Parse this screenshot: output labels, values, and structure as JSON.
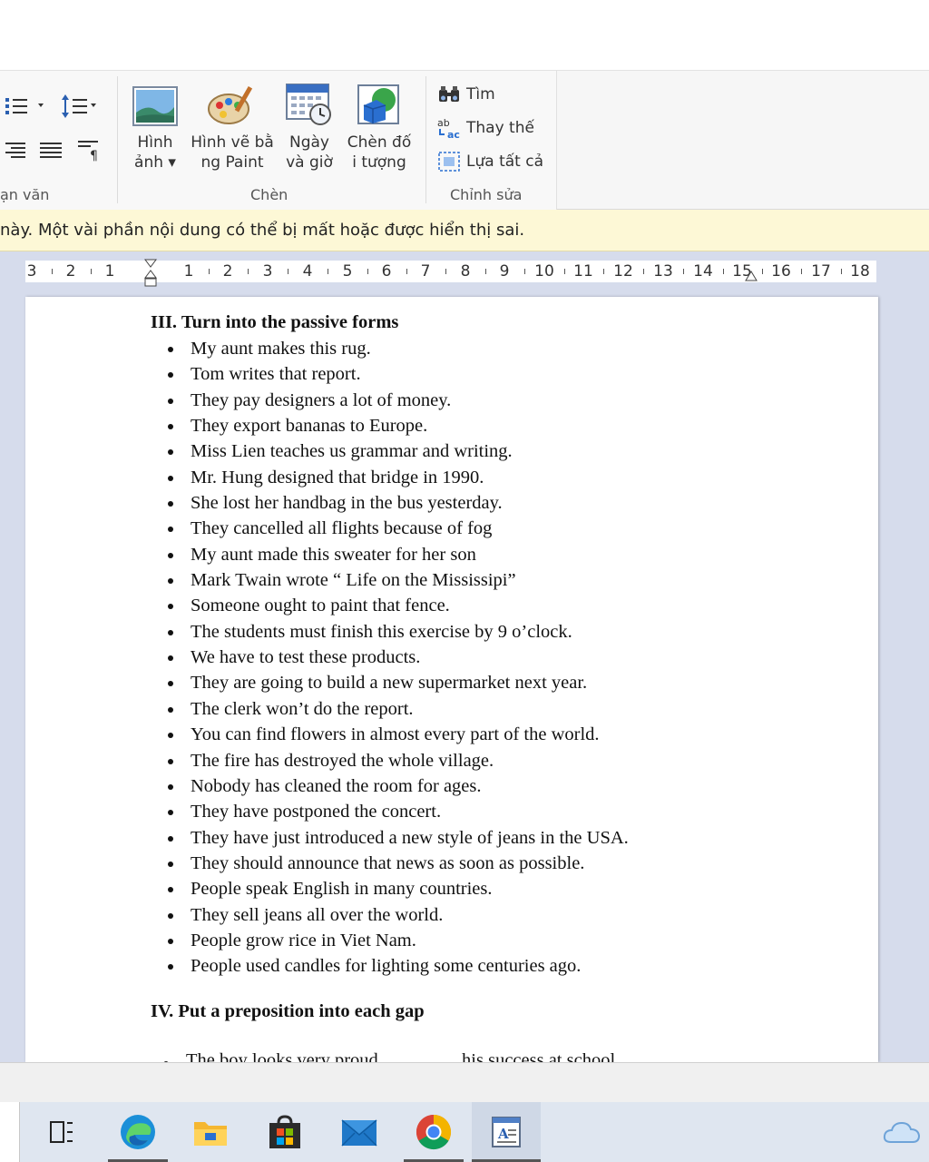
{
  "ribbon": {
    "groups": {
      "paragraph": "ạn văn",
      "insert": "Chèn",
      "editing": "Chỉnh sửa"
    },
    "insert_buttons": {
      "picture": {
        "line1": "Hình",
        "line2": "ảnh ▾"
      },
      "paint_drawing": {
        "line1": "Hình vẽ bằ",
        "line2": "ng Paint"
      },
      "date_time": {
        "line1": "Ngày",
        "line2": "và giờ"
      },
      "insert_object": {
        "line1": "Chèn đố",
        "line2": "i tượng"
      }
    },
    "editing_buttons": {
      "find": "Tìm",
      "replace": "Thay thế",
      "select_all": "Lựa tất cả"
    }
  },
  "warning": {
    "text": "này. Một vài phần nội dung có thể bị mất hoặc được hiển thị sai."
  },
  "ruler": {
    "labels": [
      "3",
      "2",
      "1",
      "1",
      "2",
      "3",
      "4",
      "5",
      "6",
      "7",
      "8",
      "9",
      "10",
      "11",
      "12",
      "13",
      "14",
      "15",
      "16",
      "17",
      "18"
    ]
  },
  "document": {
    "section3_title": "III. Turn into the passive forms",
    "section3_items": [
      "My aunt makes this rug.",
      "Tom writes that report.",
      "They pay designers a lot of money.",
      "They export bananas to Europe.",
      "Miss Lien teaches us grammar and writing.",
      "Mr. Hung designed that bridge in 1990.",
      "She lost her handbag in the bus yesterday.",
      "They cancelled all flights because of fog",
      "My aunt made this sweater for her son",
      "Mark Twain wrote “ Life on the Mississipi”",
      "Someone ought to paint that fence.",
      "The students must finish this exercise by 9 o’clock.",
      "We have to test these products.",
      "They are going to build a new supermarket next year.",
      "The clerk won’t do the report.",
      "You can find flowers in almost every part of the world.",
      "The fire has destroyed the whole village.",
      "Nobody has cleaned the room for ages.",
      "They have postponed the concert.",
      "They have just introduced a new style of jeans in the USA.",
      "They should announce that news as soon as possible.",
      "People speak English in many countries.",
      "They sell jeans all over the world.",
      "People grow rice in Viet Nam.",
      "People used candles for lighting some centuries ago."
    ],
    "section4_title": "IV. Put a preposition into each gap",
    "section4_partial": "The boy looks very proud ________ his success at school."
  },
  "colors": {
    "warning_bg": "#fdf8d6",
    "workspace_bg": "#d6dcec",
    "taskbar_bg": "#dfe6f0"
  }
}
